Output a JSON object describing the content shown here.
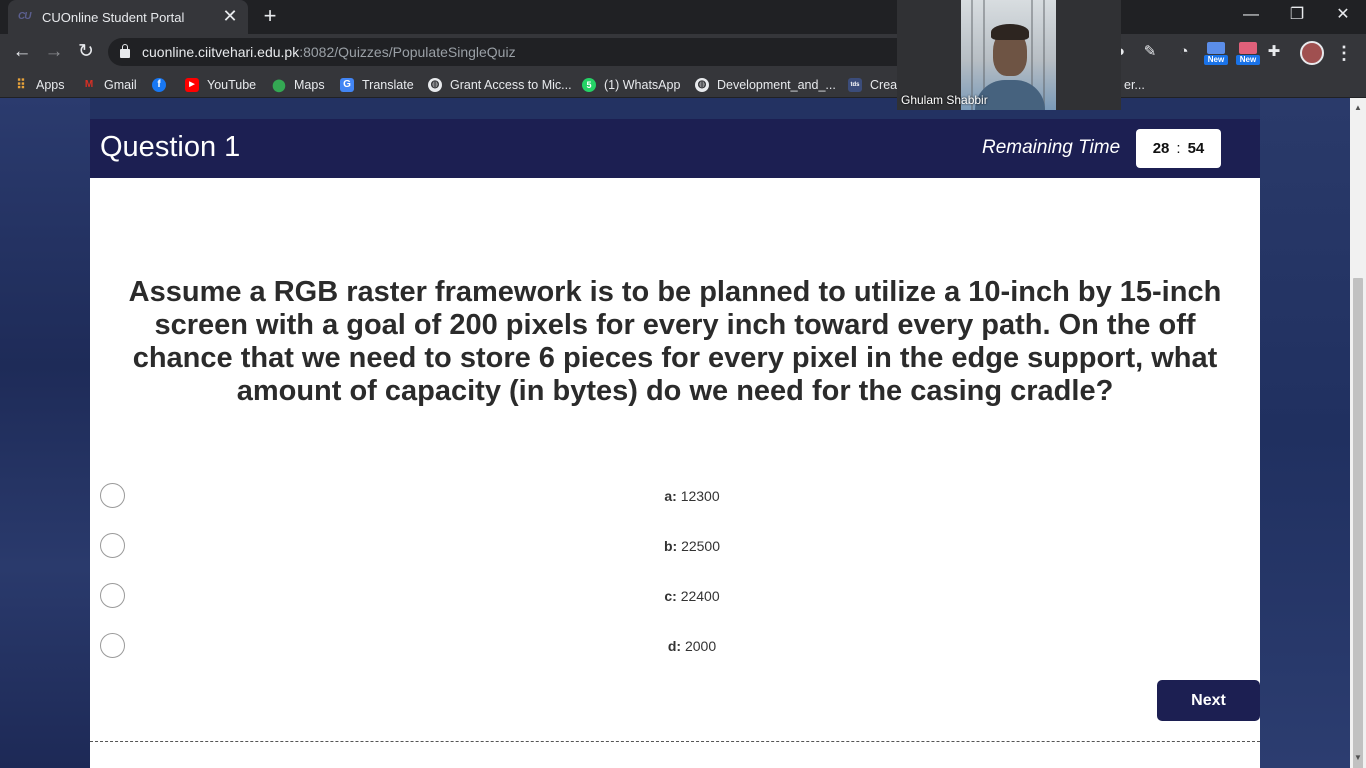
{
  "browser": {
    "tab": {
      "title": "CUOnline Student Portal",
      "favicon_text": "CU",
      "close": "✕"
    },
    "new_tab": "+",
    "window_controls": {
      "minimize": "—",
      "restore": "❐",
      "close": "✕"
    },
    "nav": {
      "back": "←",
      "forward": "→",
      "reload": "↻"
    },
    "url": {
      "host": "cuonline.ciitvehari.edu.pk",
      "rest": ":8082/Quizzes/PopulateSingleQuiz"
    },
    "extensions": {
      "new_badge_1": "New",
      "new_badge_2": "New",
      "more": "⋮"
    },
    "bookmarks": [
      {
        "label": "Apps",
        "icon": "apps-grid-icon",
        "color": "#e8a33a"
      },
      {
        "label": "Gmail",
        "icon": "gmail-icon",
        "color": "#d93025"
      },
      {
        "label": "",
        "icon": "facebook-icon",
        "color": "#1877f2"
      },
      {
        "label": "YouTube",
        "icon": "youtube-icon",
        "color": "#ff0000"
      },
      {
        "label": "Maps",
        "icon": "maps-pin-icon",
        "color": "#34a853"
      },
      {
        "label": "Translate",
        "icon": "translate-icon",
        "color": "#4285f4"
      },
      {
        "label": "Grant Access to Mic...",
        "icon": "globe-icon",
        "color": "#e8eaed"
      },
      {
        "label": "(1) WhatsApp",
        "icon": "whatsapp-icon",
        "color": "#25d366"
      },
      {
        "label": "Development_and_...",
        "icon": "globe-icon",
        "color": "#e8eaed"
      },
      {
        "label": "Crea",
        "icon": "tds-icon",
        "color": "#3b4c7a"
      },
      {
        "label": "er...",
        "icon": "",
        "color": ""
      }
    ]
  },
  "video_call": {
    "participant_name": "Ghulam Shabbir"
  },
  "quiz": {
    "title": "Question 1",
    "remaining_time_label": "Remaining Time",
    "timer": {
      "minutes": "28",
      "separator": ":",
      "seconds": "54"
    },
    "question": "Assume a RGB raster framework is to be planned to utilize a 10-inch by 15-inch screen with a goal of 200 pixels for every inch toward every path. On the off chance that we need to store 6 pieces for every pixel in the edge support, what amount of capacity (in bytes) do we need for the casing cradle?",
    "options": [
      {
        "key": "a:",
        "value": "12300"
      },
      {
        "key": "b:",
        "value": "22500"
      },
      {
        "key": "c:",
        "value": "22400"
      },
      {
        "key": "d:",
        "value": "2000"
      }
    ],
    "next_label": "Next"
  },
  "colors": {
    "header_bg": "#1c1f52",
    "page_bg": "#233262",
    "button_bg": "#1c1f52"
  }
}
